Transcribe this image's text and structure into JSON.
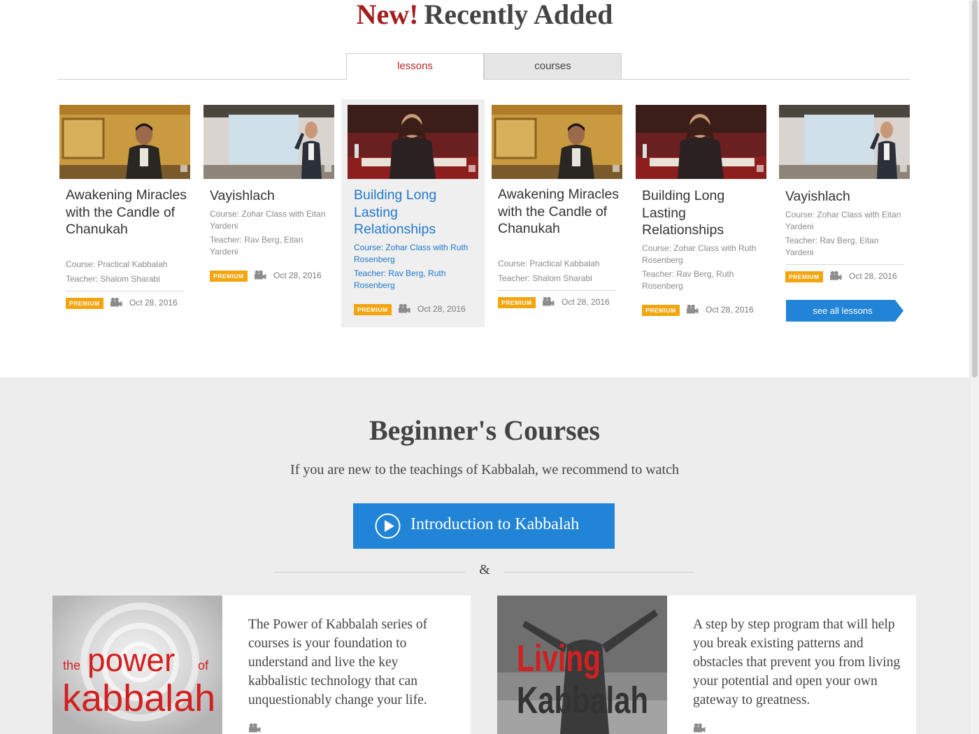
{
  "header": {
    "new_label": "New!",
    "title": "Recently Added"
  },
  "tabs": [
    {
      "label": "lessons",
      "active": true
    },
    {
      "label": "courses",
      "active": false
    }
  ],
  "cards": [
    {
      "title": "Awakening Miracles with the Candle of Chanukah",
      "course": "Course: Practical Kabbalah",
      "teacher": "Teacher: Shalom Sharabi",
      "badge": "PREMIUM",
      "date": "Oct 28, 2016"
    },
    {
      "title": "Vayishlach",
      "course": "Course: Zohar Class with Eitan Yardeni",
      "teacher": "Teacher: Rav Berg, Eitan Yardeni",
      "badge": "PREMIUM",
      "date": "Oct 28, 2016"
    },
    {
      "title": "Building Long Lasting Relationships",
      "course": "Course: Zohar Class with Ruth Rosenberg",
      "teacher": "Teacher: Rav Berg, Ruth Rosenberg",
      "badge": "PREMIUM",
      "date": "Oct 28, 2016"
    },
    {
      "title": "Awakening Miracles with the Candle of Chanukah",
      "course": "Course: Practical Kabbalah",
      "teacher": "Teacher: Shalom Sharabi",
      "badge": "PREMIUM",
      "date": "Oct 28, 2016"
    },
    {
      "title": "Building Long Lasting Relationships",
      "course": "Course: Zohar Class with Ruth Rosenberg",
      "teacher": "Teacher: Rav Berg, Ruth Rosenberg",
      "badge": "PREMIUM",
      "date": "Oct 28, 2016"
    },
    {
      "title": "Vayishlach",
      "course": "Course: Zohar Class with Eitan Yardeni",
      "teacher": "Teacher: Rav Berg, Eitan Yardeni",
      "badge": "PREMIUM",
      "date": "Oct 28, 2016"
    }
  ],
  "see_all_label": "see all lessons",
  "beginner": {
    "title": "Beginner's Courses",
    "subtitle": "If you are new to the teachings of Kabbalah, we recommend to watch",
    "intro_button": "Introduction to Kabbalah",
    "ampersand": "&",
    "courses": [
      {
        "logo": "the power of kabbalah",
        "description": "The Power of Kabbalah series of courses is your foundation to understand and live the key kabbalistic technology that can unquestionably change your life."
      },
      {
        "logo": "Living Kabbalah",
        "description": "A step by step program that will help you break existing patterns and obstacles that prevent you from living your potential and open your own gateway to greatness."
      }
    ]
  },
  "colors": {
    "accent_red": "#a31d1d",
    "link_blue": "#2179cc",
    "button_blue": "#2184d6",
    "premium": "#f3a510"
  },
  "icons": {
    "media": "video-camera-icon",
    "play": "play-circle-icon"
  }
}
